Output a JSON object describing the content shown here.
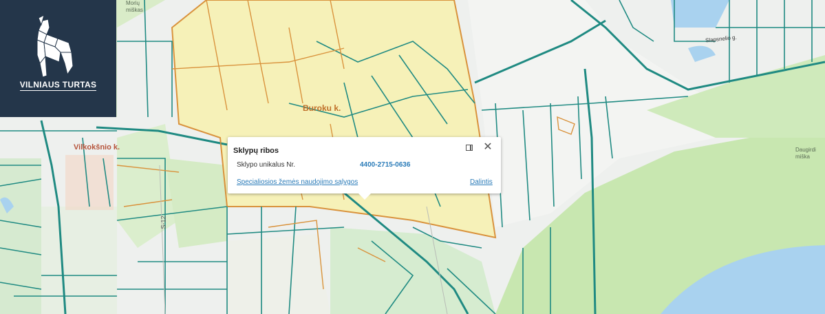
{
  "logo": {
    "name": "VILNIAUS TURTAS",
    "icon": "wolf-icon"
  },
  "popup": {
    "title": "Sklypų ribos",
    "field_label": "Sklypo unikalus Nr.",
    "field_value": "4400-2715-0636",
    "link_left": "Specialiosios žemės naudojimo sąlygos",
    "link_right": "Dalintis",
    "maximize_icon": "maximize-icon",
    "close_icon": "close-icon"
  },
  "map_labels": {
    "burokai": "Buroku k.",
    "vilkoksnio": "Vilkokšnio k.",
    "road": "S-12",
    "forest": "Daugirdi\nmiška",
    "forest_top": "Morių\nmiškas",
    "street": "Slapsnelio g."
  },
  "colors": {
    "parcel_line": "#1f8a82",
    "yellow_zone": "#f6f1b8",
    "orange_border": "#d9923c",
    "forest": "#c8e7b0",
    "water": "#a9d2ef",
    "logo_bg": "#24364a"
  }
}
